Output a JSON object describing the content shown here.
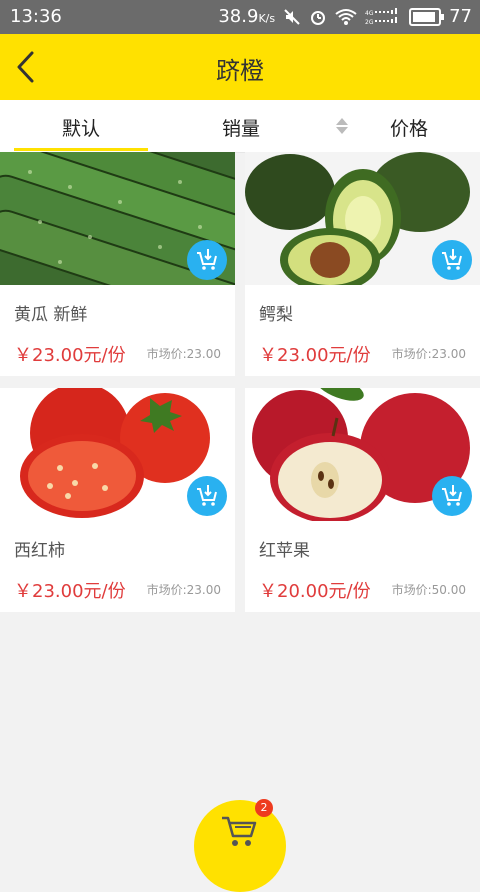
{
  "status_bar": {
    "time": "13:36",
    "speed": "38.9",
    "speed_unit": "K/s",
    "battery": "77"
  },
  "header": {
    "title": "跻橙"
  },
  "tabs": [
    {
      "label": "默认"
    },
    {
      "label": "销量"
    },
    {
      "label": "价格"
    }
  ],
  "products": [
    {
      "name": "黄瓜  新鲜",
      "price": "￥23.00元/份",
      "market_price": "市场价:23.00",
      "icon": "cucumber-image"
    },
    {
      "name": "鳄梨",
      "price": "￥23.00元/份",
      "market_price": "市场价:23.00",
      "icon": "avocado-image"
    },
    {
      "name": "西红柿",
      "price": "￥23.00元/份",
      "market_price": "市场价:23.00",
      "icon": "tomato-image"
    },
    {
      "name": "红苹果",
      "price": "￥20.00元/份",
      "market_price": "市场价:50.00",
      "icon": "apple-image"
    }
  ],
  "cart": {
    "count": "2"
  },
  "colors": {
    "accent": "#ffe100",
    "price": "#e03c3c",
    "cart_button": "#29b1f0",
    "badge": "#ee3b1f"
  }
}
